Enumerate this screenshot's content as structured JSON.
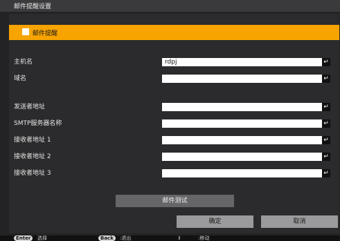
{
  "window": {
    "title": "邮件提醒设置"
  },
  "toggle": {
    "label": "邮件提醒",
    "checked": false
  },
  "fields": [
    {
      "label": "主机名",
      "value": "rdpj"
    },
    {
      "label": "域名",
      "value": ""
    },
    {
      "label": "发送者地址",
      "value": ""
    },
    {
      "label": "SMTP服务器名称",
      "value": ""
    },
    {
      "label": "接收者地址 1",
      "value": ""
    },
    {
      "label": "接收者地址 2",
      "value": ""
    },
    {
      "label": "接收者地址 3",
      "value": ""
    }
  ],
  "enter_glyph": "↵",
  "buttons": {
    "test": "邮件测试",
    "ok": "确定",
    "cancel": "取消"
  },
  "status": {
    "enter_key": "Enter",
    "enter_text": "选择",
    "back_key": "Back",
    "back_text": ":退出",
    "move_glyph": "⇕",
    "move_text": ":移动"
  },
  "colors": {
    "accent": "#f7a400",
    "background": "#2b2b2d",
    "titlebar": "#3a3a3c"
  }
}
